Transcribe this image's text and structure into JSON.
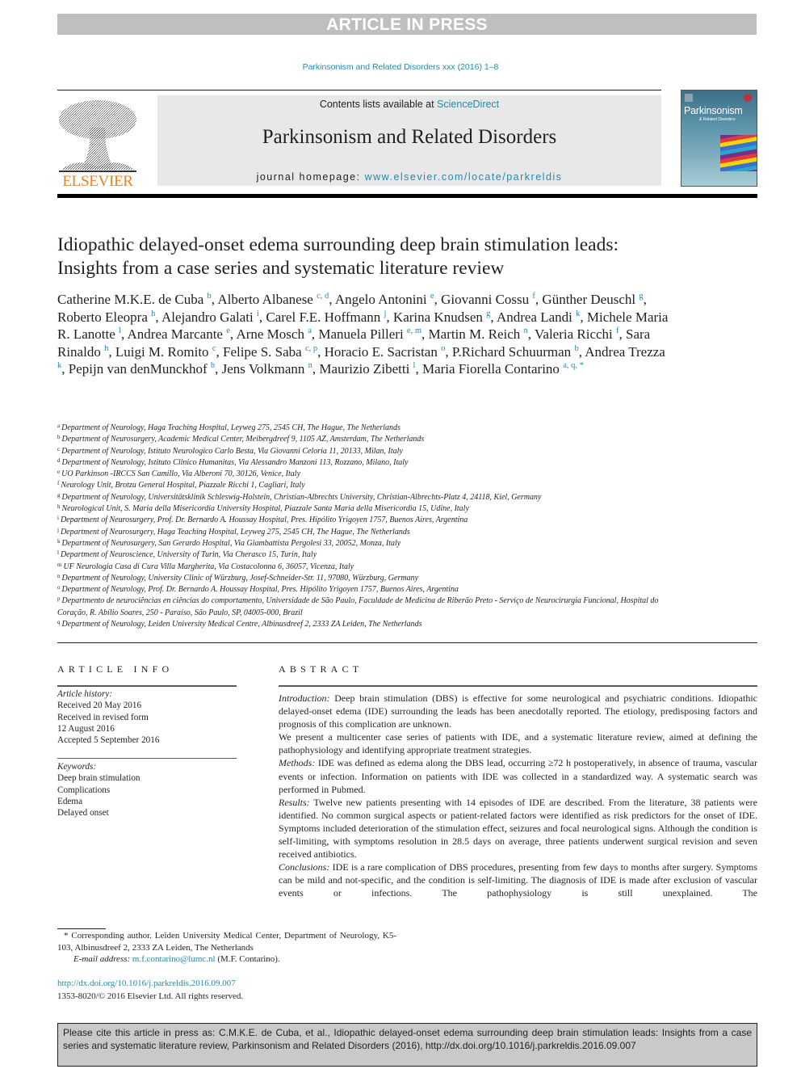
{
  "banner": "ARTICLE IN PRESS",
  "journal_ref": "Parkinsonism and Related Disorders xxx (2016) 1–8",
  "header": {
    "publisher_logo": "ELSEVIER",
    "publisher_logo_color": "#f07f1a",
    "contents_prefix": "Contents lists available at ",
    "contents_link": "ScienceDirect",
    "journal_title": "Parkinsonism and Related Disorders",
    "homepage_prefix": "journal homepage: ",
    "homepage_url": "www.elsevier.com/locate/parkreldis",
    "cover_title": "Parkinsonism",
    "cover_subtitle": "& Related Disorders"
  },
  "article": {
    "title": "Idiopathic delayed-onset edema surrounding deep brain stimulation leads: Insights from a case series and systematic literature review",
    "authors": [
      {
        "name": "Catherine M.K.E. de Cuba",
        "aff": "b"
      },
      {
        "name": "Alberto Albanese",
        "aff": "c, d"
      },
      {
        "name": "Angelo Antonini",
        "aff": "e"
      },
      {
        "name": "Giovanni Cossu",
        "aff": "f"
      },
      {
        "name": "Günther Deuschl",
        "aff": "g"
      },
      {
        "name": "Roberto Eleopra",
        "aff": "h"
      },
      {
        "name": "Alejandro Galati",
        "aff": "i"
      },
      {
        "name": "Carel F.E. Hoffmann",
        "aff": "j"
      },
      {
        "name": "Karina Knudsen",
        "aff": "g"
      },
      {
        "name": "Andrea Landi",
        "aff": "k"
      },
      {
        "name": "Michele Maria R. Lanotte",
        "aff": "l"
      },
      {
        "name": "Andrea Marcante",
        "aff": "e"
      },
      {
        "name": "Arne Mosch",
        "aff": "a"
      },
      {
        "name": "Manuela Pilleri",
        "aff": "e, m"
      },
      {
        "name": "Martin M. Reich",
        "aff": "n"
      },
      {
        "name": "Valeria Ricchi",
        "aff": "f"
      },
      {
        "name": "Sara Rinaldo",
        "aff": "h"
      },
      {
        "name": "Luigi M. Romito",
        "aff": "c"
      },
      {
        "name": "Felipe S. Saba",
        "aff": "c, p"
      },
      {
        "name": "Horacio E. Sacristan",
        "aff": "o"
      },
      {
        "name": "P.Richard Schuurman",
        "aff": "b"
      },
      {
        "name": "Andrea Trezza",
        "aff": "k"
      },
      {
        "name": "Pepijn van denMunckhof",
        "aff": "b"
      },
      {
        "name": "Jens Volkmann",
        "aff": "n"
      },
      {
        "name": "Maurizio Zibetti",
        "aff": "l"
      },
      {
        "name": "Maria Fiorella Contarino",
        "aff": "a, q, *"
      }
    ],
    "affiliations": [
      {
        "key": "a",
        "text": "Department of Neurology, Haga Teaching Hospital, Leyweg 275, 2545 CH, The Hague, The Netherlands"
      },
      {
        "key": "b",
        "text": "Department of Neurosurgery, Academic Medical Center, Meibergdreef 9, 1105 AZ, Amsterdam, The Netherlands"
      },
      {
        "key": "c",
        "text": "Department of Neurology, Istituto Neurologico Carlo Besta, Via Giovanni Celoria 11, 20133, Milan, Italy"
      },
      {
        "key": "d",
        "text": "Department of Neurology, Istituto Clinico Humanitas, Via Alessandro Manzoni 113, Rozzano, Milano, Italy"
      },
      {
        "key": "e",
        "text": "UO Parkinson -IRCCS San Camillo, Via Alberoni 70, 30126, Venice, Italy"
      },
      {
        "key": "f",
        "text": "Neurology Unit, Brotzu General Hospital, Piazzale Ricchi 1, Cagliari, Italy"
      },
      {
        "key": "g",
        "text": "Department of Neurology, Universitätsklinik Schleswig-Holstein, Christian-Albrechts University, Christian-Albrechts-Platz 4, 24118, Kiel, Germany"
      },
      {
        "key": "h",
        "text": "Neurological Unit, S. Maria della Misericordia University Hospital, Piazzale Santa Maria della Misericordia 15, Udine, Italy"
      },
      {
        "key": "i",
        "text": "Department of Neurosurgery, Prof. Dr. Bernardo A. Houssay Hospital, Pres. Hipólito Yrigoyen 1757, Buenos Aires, Argentina"
      },
      {
        "key": "j",
        "text": "Department of Neurosurgery, Haga Teaching Hospital, Leyweg 275, 2545 CH, The Hague, The Netherlands"
      },
      {
        "key": "k",
        "text": "Department of Neurosurgery, San Gerardo Hospital, Via Giambattista Pergolesi 33, 20052, Monza, Italy"
      },
      {
        "key": "l",
        "text": "Department of Neuroscience, University of Turin, Via Cherasco 15, Turin, Italy"
      },
      {
        "key": "m",
        "text": "UF Neurologia Casa di Cura Villa Margherita, Via Costacolonna 6, 36057, Vicenza, Italy"
      },
      {
        "key": "n",
        "text": "Department of Neurology, University Clinic of Würzburg, Josef-Schneider-Str. 11, 97080, Würzburg, Germany"
      },
      {
        "key": "o",
        "text": "Department of Neurology, Prof. Dr. Bernardo A. Houssay Hospital, Pres. Hipólito Yrigoyen 1757, Buenos Aires, Argentina"
      },
      {
        "key": "p",
        "text": "Departmento de neurociências en ciências do comportamento, Universidade de São Paulo, Faculdade de Medicina de Riberão Preto - Serviço de Neurocirurgia Funcional, Hospital do Coração, R. Abílio Soares, 250 - Paraíso, São Paulo, SP, 04005-000, Brazil"
      },
      {
        "key": "q",
        "text": "Department of Neurology, Leiden University Medical Centre, Albinusdreef 2, 2333 ZA Leiden, The Netherlands"
      }
    ]
  },
  "article_info": {
    "heading": "ARTICLE INFO",
    "history_label": "Article history:",
    "history": [
      "Received 20 May 2016",
      "Received in revised form",
      "12 August 2016",
      "Accepted 5 September 2016"
    ],
    "keywords_label": "Keywords:",
    "keywords": [
      "Deep brain stimulation",
      "Complications",
      "Edema",
      "Delayed onset"
    ]
  },
  "abstract": {
    "heading": "ABSTRACT",
    "sections": [
      {
        "label": "Introduction:",
        "text": " Deep brain stimulation (DBS) is effective for some neurological and psychiatric conditions. Idiopathic delayed-onset edema (IDE) surrounding the leads has been anecdotally reported. The etiology, predisposing factors and prognosis of this complication are unknown."
      },
      {
        "label": "",
        "text": "We present a multicenter case series of patients with IDE, and a systematic literature review, aimed at defining the pathophysiology and identifying appropriate treatment strategies."
      },
      {
        "label": "Methods:",
        "text": " IDE was defined as edema along the DBS lead, occurring ≥72 h postoperatively, in absence of trauma, vascular events or infection. Information on patients with IDE was collected in a standardized way. A systematic search was performed in Pubmed."
      },
      {
        "label": "Results:",
        "text": " Twelve new patients presenting with 14 episodes of IDE are described. From the literature, 38 patients were identified. No common surgical aspects or patient-related factors were identified as risk predictors for the onset of IDE. Symptoms included deterioration of the stimulation effect, seizures and focal neurological signs. Although the condition is self-limiting, with symptoms resolution in 28.5 days on average, three patients underwent surgical revision and seven received antibiotics."
      },
      {
        "label": "Conclusions:",
        "text": " IDE is a rare complication of DBS procedures, presenting from few days to months after surgery. Symptoms can be mild and not-specific, and the condition is self-limiting. The diagnosis of IDE is made after exclusion of vascular events or infections. The pathophysiology is still unexplained. The"
      }
    ]
  },
  "footnote": {
    "corresponding": "* Corresponding author. Leiden University Medical Center, Department of Neurology, K5-103, Albinusdreef 2, 2333 ZA Leiden, The Netherlands",
    "email_label": "E-mail address:",
    "email": "m.f.contarino@lumc.nl",
    "email_suffix": " (M.F. Contarino).",
    "doi": "http://dx.doi.org/10.1016/j.parkreldis.2016.09.007",
    "copyright": "1353-8020/© 2016 Elsevier Ltd. All rights reserved."
  },
  "citation_box": "Please cite this article in press as: C.M.K.E. de Cuba, et al., Idiopathic delayed-onset edema surrounding deep brain stimulation leads: Insights from a case series and systematic literature review, Parkinsonism and Related Disorders (2016), http://dx.doi.org/10.1016/j.parkreldis.2016.09.007",
  "colors": {
    "link": "#1e8bb5",
    "banner": "#bfbfbf",
    "header_box": "#e8e8e8",
    "citation_box": "#c9c9c9"
  }
}
